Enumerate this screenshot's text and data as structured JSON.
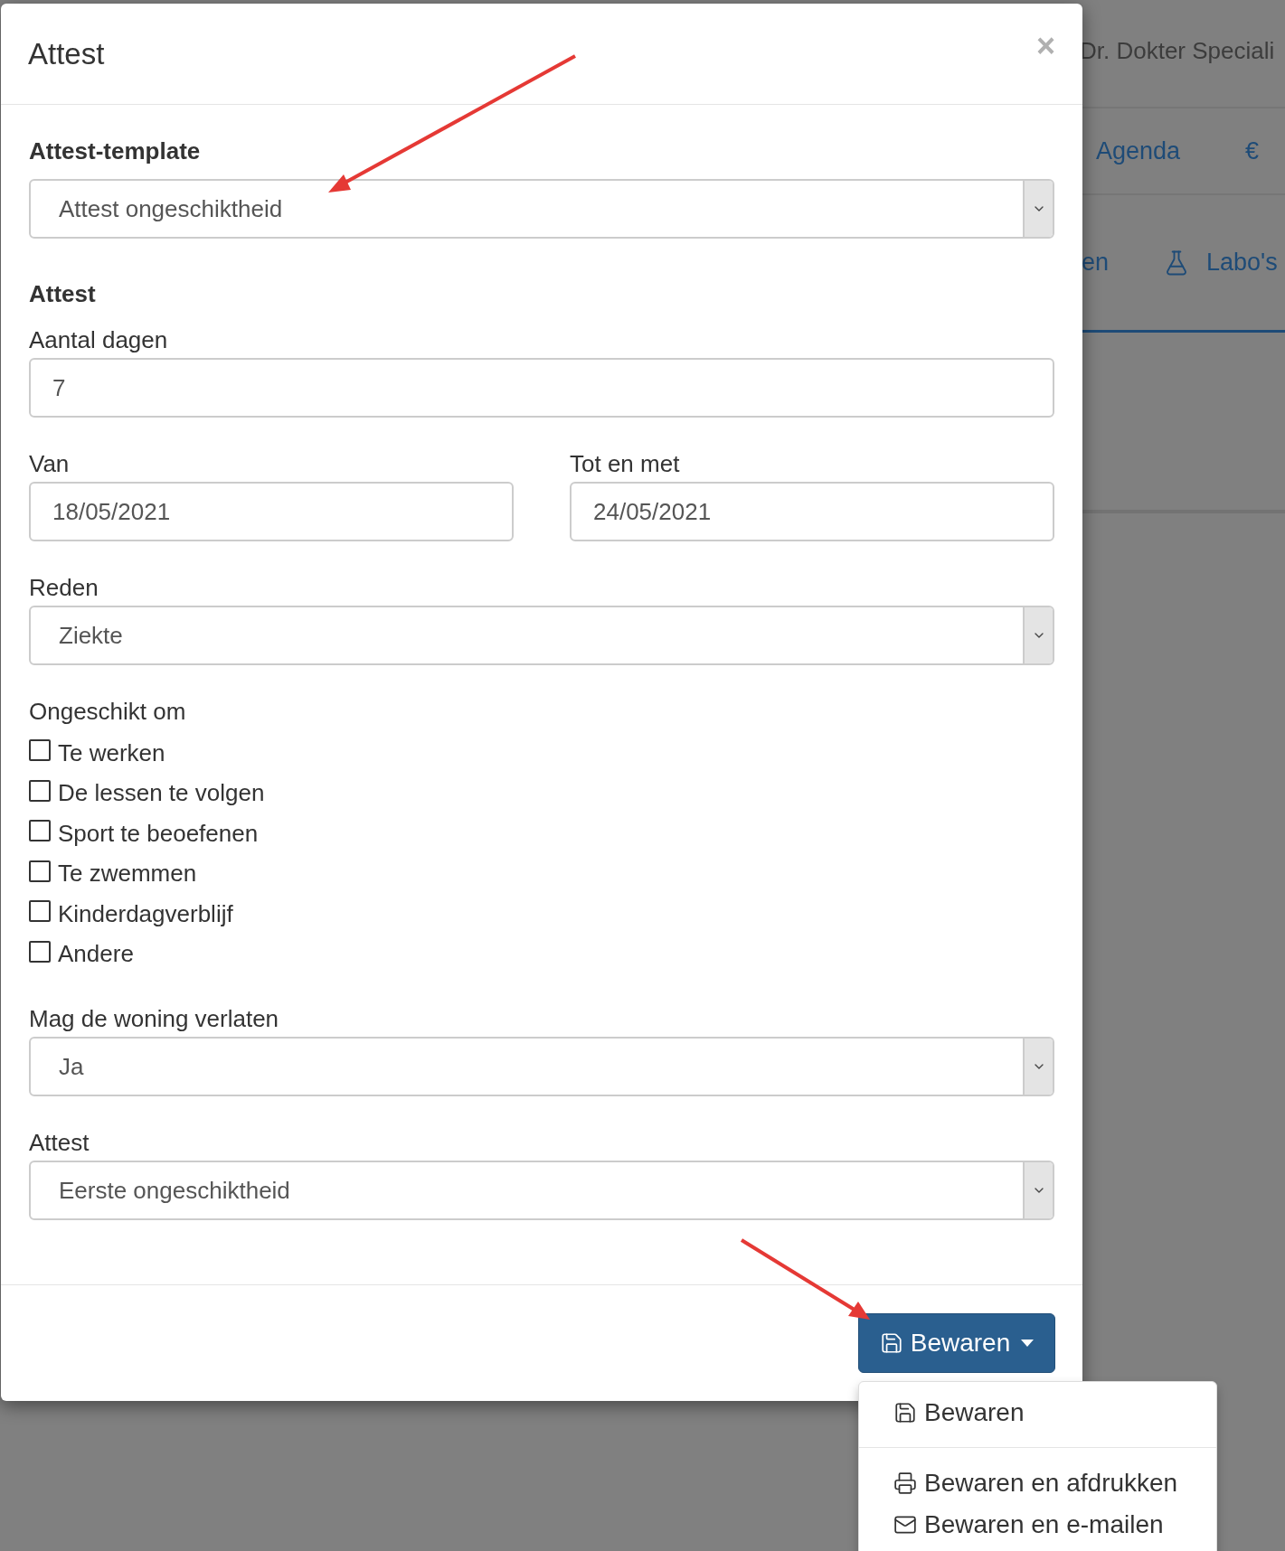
{
  "background": {
    "doctor_name": "Dr. Dokter Speciali",
    "nav": [
      {
        "label": "Agenda"
      },
      {
        "label": "€"
      }
    ],
    "tabs": [
      {
        "label": "en",
        "kind": "plain"
      },
      {
        "label": "Labo's",
        "kind": "flask"
      }
    ]
  },
  "modal": {
    "title": "Attest",
    "close": "×",
    "template": {
      "label": "Attest-template",
      "value": "Attest ongeschiktheid"
    },
    "section": "Attest",
    "days": {
      "label": "Aantal dagen",
      "value": "7"
    },
    "from": {
      "label": "Van",
      "value": "18/05/2021"
    },
    "to": {
      "label": "Tot en met",
      "value": "24/05/2021"
    },
    "reason": {
      "label": "Reden",
      "value": "Ziekte"
    },
    "unfit": {
      "label": "Ongeschikt om",
      "options": [
        {
          "label": "Te werken",
          "checked": false
        },
        {
          "label": "De lessen te volgen",
          "checked": false
        },
        {
          "label": "Sport te beoefenen",
          "checked": false
        },
        {
          "label": "Te zwemmen",
          "checked": false
        },
        {
          "label": "Kinderdagverblijf",
          "checked": false
        },
        {
          "label": "Andere",
          "checked": false
        }
      ]
    },
    "leave_home": {
      "label": "Mag de woning verlaten",
      "value": "Ja"
    },
    "certificate": {
      "label": "Attest",
      "value": "Eerste ongeschiktheid"
    },
    "save_button": {
      "label": "Bewaren"
    },
    "save_menu": [
      {
        "label": "Bewaren",
        "kind": "save"
      },
      {
        "label": "Bewaren en afdrukken",
        "kind": "print"
      },
      {
        "label": "Bewaren en e-mailen",
        "kind": "mail"
      }
    ]
  }
}
